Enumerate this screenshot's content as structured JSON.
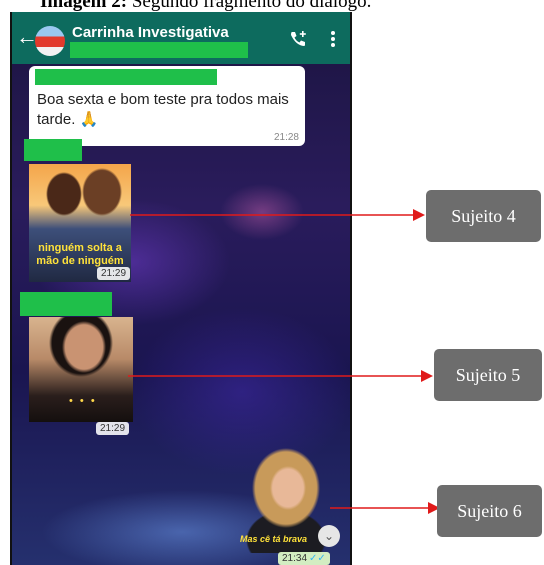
{
  "figure": {
    "title_label": "Imagem 2:",
    "title_text": "Segundo fragmento do diálogo."
  },
  "chat": {
    "title": "Carrinha Investigativa",
    "header_color": "#0d6b5e",
    "redaction_color": "#1fbf4a",
    "messages": [
      {
        "type": "text",
        "body": "Boa sexta e bom teste pra todos mais tarde. 🙏",
        "time": "21:28"
      },
      {
        "type": "image",
        "caption": "ninguém solta a mão de ninguém",
        "time": "21:29"
      },
      {
        "type": "image",
        "caption": "• • •",
        "time": "21:29"
      },
      {
        "type": "sticker",
        "caption": "Mas cê tá brava",
        "time": "21:34",
        "status": "✓✓"
      }
    ]
  },
  "annotations": [
    "Sujeito 4",
    "Sujeito 5",
    "Sujeito 6"
  ],
  "icons": {
    "back": "arrow-left",
    "add_call": "phone-plus",
    "menu": "vertical-ellipsis",
    "scroll": "double-chevron-down"
  }
}
